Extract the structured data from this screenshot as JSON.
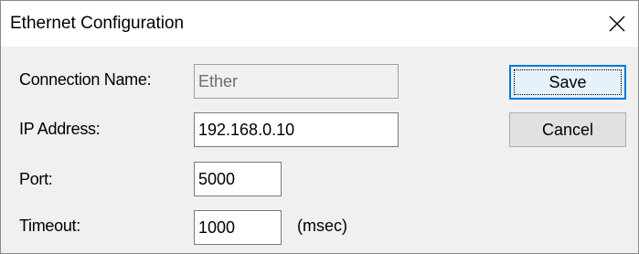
{
  "window": {
    "title": "Ethernet Configuration",
    "close_icon": "close-icon"
  },
  "form": {
    "connection_name": {
      "label": "Connection Name:",
      "value": "Ether",
      "disabled": true
    },
    "ip_address": {
      "label": "IP Address:",
      "value": "192.168.0.10"
    },
    "port": {
      "label": "Port:",
      "value": "5000"
    },
    "timeout": {
      "label": "Timeout:",
      "value": "1000",
      "unit": "(msec)"
    }
  },
  "buttons": {
    "save_label": "Save",
    "cancel_label": "Cancel"
  },
  "colors": {
    "dialog_bg": "#f0f0f0",
    "titlebar_bg": "#ffffff",
    "focus_accent": "#0078d7"
  }
}
